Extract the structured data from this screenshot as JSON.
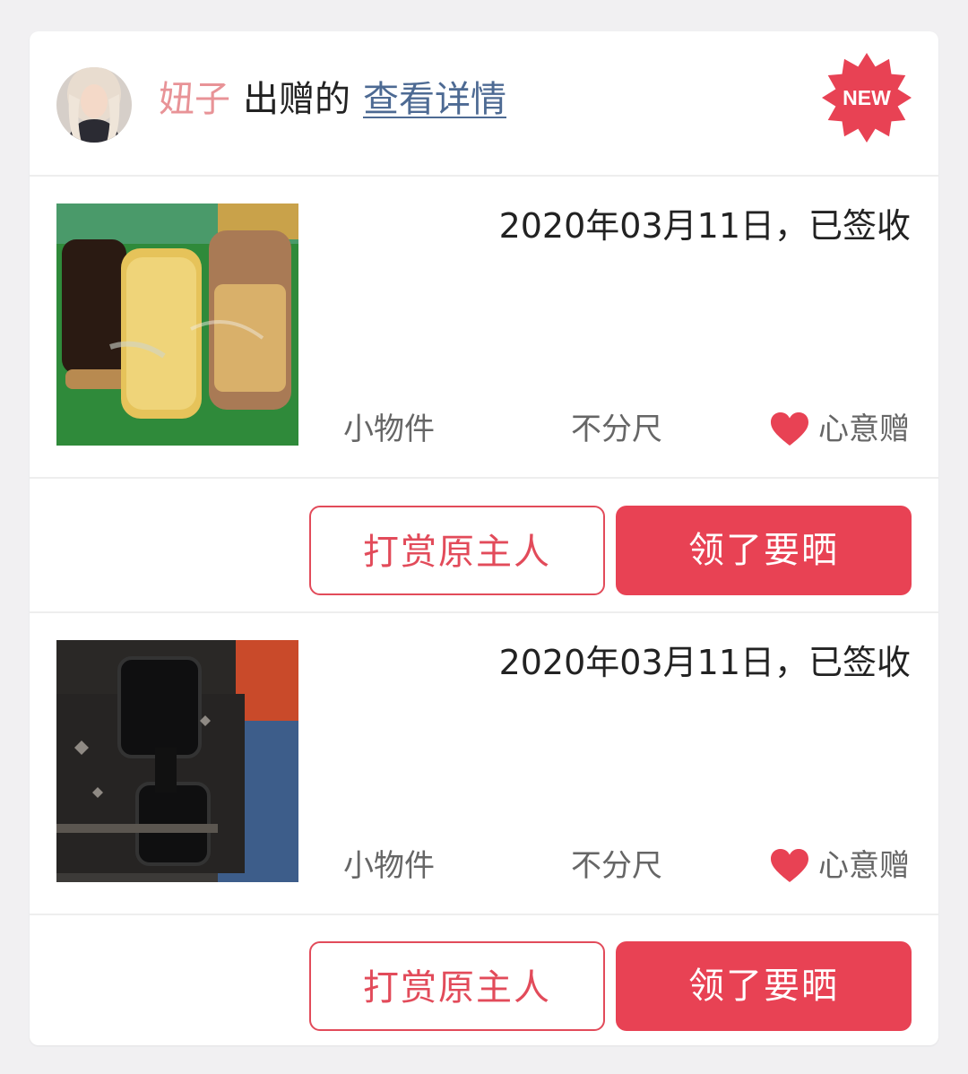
{
  "header": {
    "giver_name": "妞子",
    "verb": "出赠的",
    "detail_link": "查看详情",
    "badge": "NEW"
  },
  "items": [
    {
      "date_status": "2020年03月11日，已签收",
      "category": "小物件",
      "size": "不分尺",
      "gift_type": "心意赠",
      "reward_button": "打赏原主人",
      "share_button": "领了要晒"
    },
    {
      "date_status": "2020年03月11日，已签收",
      "category": "小物件",
      "size": "不分尺",
      "gift_type": "心意赠",
      "reward_button": "打赏原主人",
      "share_button": "领了要晒"
    }
  ],
  "colors": {
    "accent": "#e84254",
    "giver": "#e89397",
    "link": "#4d6a93"
  }
}
